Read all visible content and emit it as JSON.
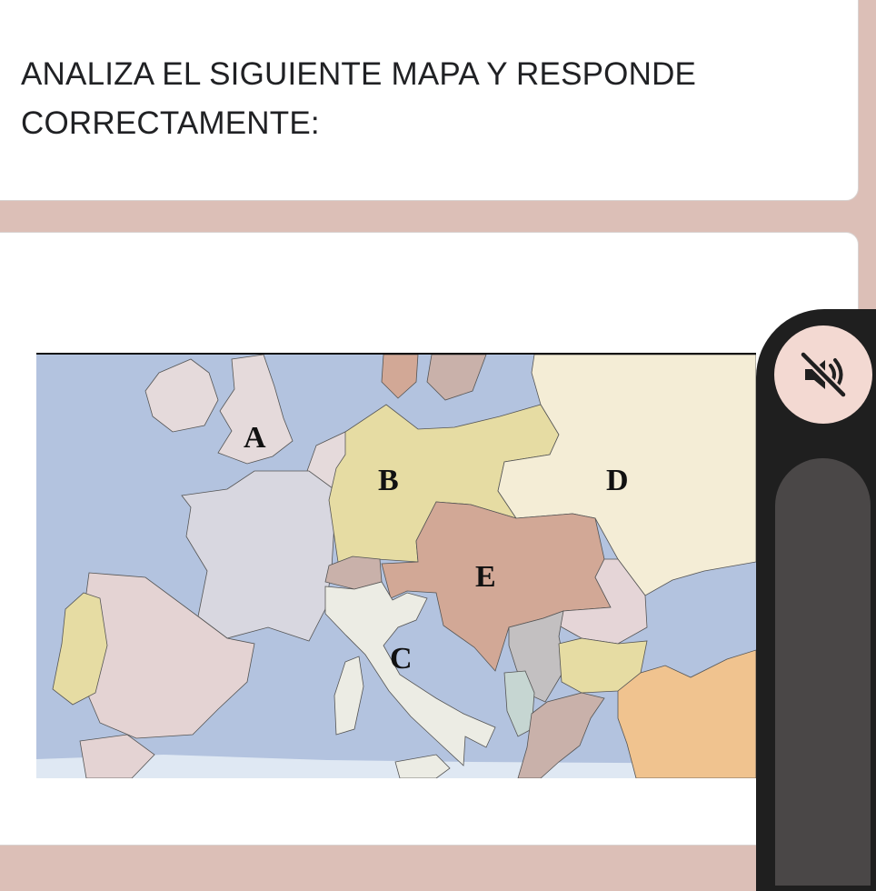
{
  "question": {
    "text": "ANALIZA EL SIGUIENTE MAPA Y RESPONDE CORRECTAMENTE:"
  },
  "map": {
    "labels": {
      "a": "A",
      "b": "B",
      "c": "C",
      "d": "D",
      "e": "E"
    },
    "colors": {
      "sea": "#b3c3df",
      "region_a_uk": "#e5dadb",
      "region_b_germany": "#e6dca3",
      "region_c_italy": "#ecece4",
      "region_d_russia": "#f4edd6",
      "region_e_austria_hungary": "#d2a896",
      "france": "#d8d7e0",
      "spain": "#e4d3d3",
      "portugal": "#e6dca3",
      "ottoman": "#f0c38f"
    }
  },
  "controls": {
    "mute_icon": "speaker-muted-icon"
  }
}
